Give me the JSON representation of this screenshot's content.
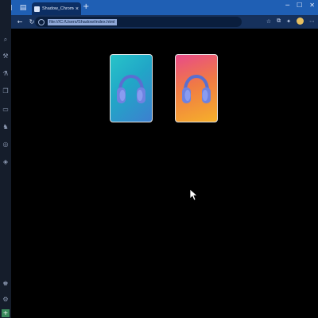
{
  "browser": {
    "tab_title": "Shadow_Chrome",
    "tab_close": "×",
    "new_tab": "+",
    "url": "file:///C:/Users/Shadow/index.html",
    "window_controls": [
      "─",
      "☐",
      "✕"
    ],
    "nav": {
      "back": "←",
      "refresh": "↻"
    },
    "toolbar_icons": [
      "☆",
      "⧉",
      "⋯"
    ]
  },
  "sidebar": {
    "icons": [
      "tab-actions-icon",
      "search-icon",
      "tools-icon",
      "flask-icon",
      "collections-icon",
      "chat-icon",
      "games-icon",
      "edge-icon",
      "office-icon",
      "shopping-icon",
      "settings-icon",
      "add-icon"
    ]
  },
  "cards": [
    {
      "name": "headphones-card-teal",
      "theme": "#27c4c9"
    },
    {
      "name": "headphones-card-sunset",
      "theme": "#f07a45"
    }
  ],
  "colors": {
    "titlebar": "#1f5fb4",
    "toolbar": "#16315c",
    "page_bg": "#000000"
  }
}
